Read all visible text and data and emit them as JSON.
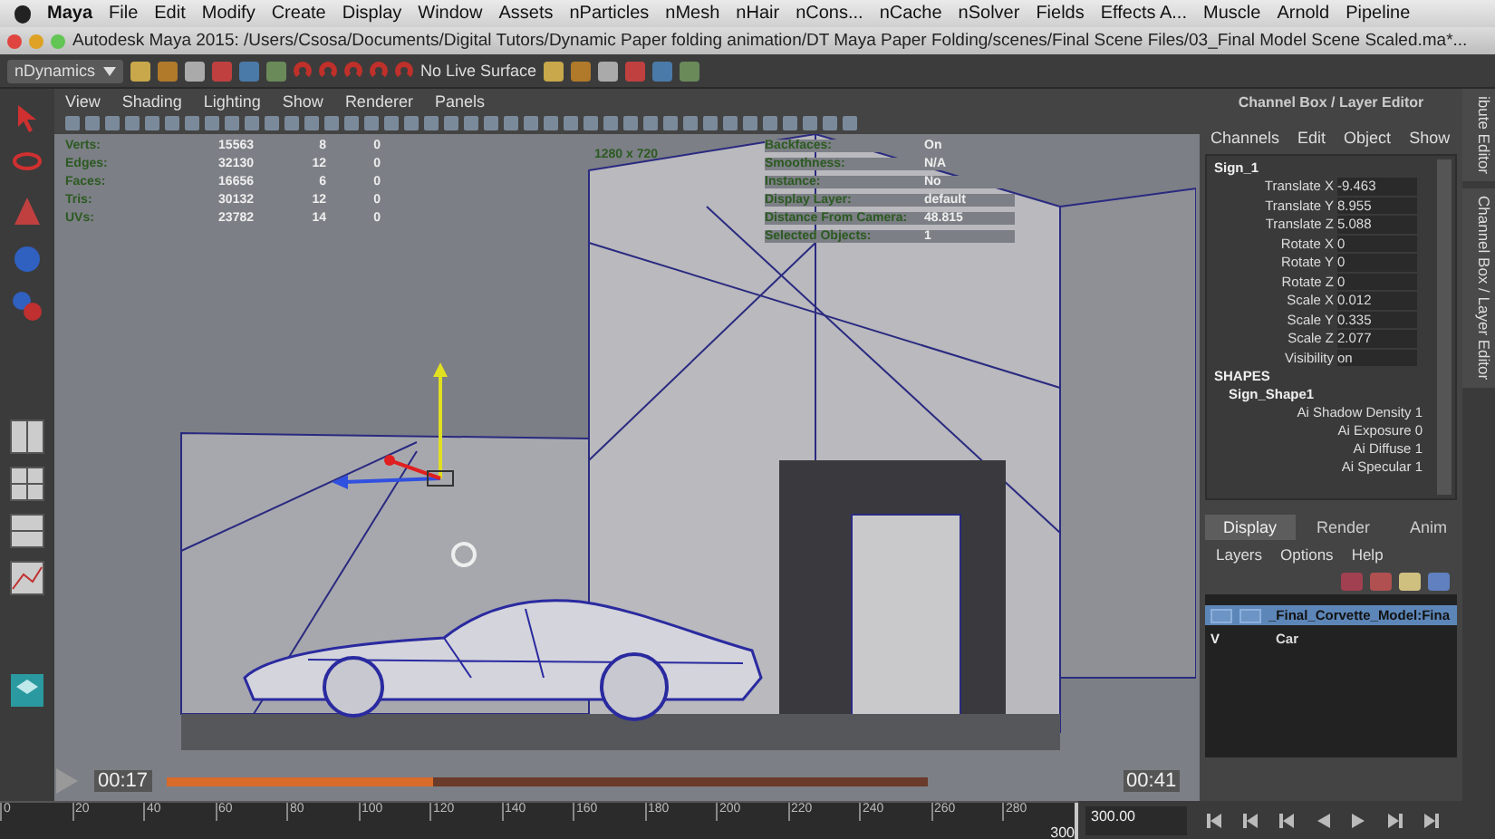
{
  "menu_bar": {
    "app": "Maya",
    "items": [
      "File",
      "Edit",
      "Modify",
      "Create",
      "Display",
      "Window",
      "Assets",
      "nParticles",
      "nMesh",
      "nHair",
      "nCons...",
      "nCache",
      "nSolver",
      "Fields",
      "Effects A...",
      "Muscle",
      "Arnold",
      "Pipeline"
    ]
  },
  "title_bar": {
    "title": "Autodesk Maya 2015: /Users/Csosa/Documents/Digital Tutors/Dynamic Paper folding animation/DT Maya Paper Folding/scenes/Final Scene Files/03_Final Model Scene Scaled.ma*..."
  },
  "toolbar": {
    "menu_set": "nDynamics",
    "live_surface": "No Live Surface"
  },
  "viewport": {
    "menus": [
      "View",
      "Shading",
      "Lighting",
      "Show",
      "Renderer",
      "Panels"
    ],
    "resolution": "1280 x 720",
    "hud_stats": [
      {
        "label": "Verts:",
        "values": [
          "15563",
          "8",
          "0"
        ]
      },
      {
        "label": "Edges:",
        "values": [
          "32130",
          "12",
          "0"
        ]
      },
      {
        "label": "Faces:",
        "values": [
          "16656",
          "6",
          "0"
        ]
      },
      {
        "label": "Tris:",
        "values": [
          "30132",
          "12",
          "0"
        ]
      },
      {
        "label": "UVs:",
        "values": [
          "23782",
          "14",
          "0"
        ]
      }
    ],
    "hud_info": [
      {
        "label": "Backfaces:",
        "value": "On"
      },
      {
        "label": "Smoothness:",
        "value": "N/A"
      },
      {
        "label": "Instance:",
        "value": "No"
      },
      {
        "label": "Display Layer:",
        "value": "default"
      },
      {
        "label": "Distance From Camera:",
        "value": "48.815"
      },
      {
        "label": "Selected Objects:",
        "value": "1"
      }
    ]
  },
  "video_player": {
    "elapsed": "00:17",
    "remaining": "00:41",
    "level": 0.35
  },
  "channel_box": {
    "title": "Channel Box / Layer Editor",
    "menus": [
      "Channels",
      "Edit",
      "Object",
      "Show"
    ],
    "object": "Sign_1",
    "channels": [
      {
        "name": "Translate X",
        "value": "-9.463"
      },
      {
        "name": "Translate Y",
        "value": "8.955"
      },
      {
        "name": "Translate Z",
        "value": "5.088"
      },
      {
        "name": "Rotate X",
        "value": "0"
      },
      {
        "name": "Rotate Y",
        "value": "0"
      },
      {
        "name": "Rotate Z",
        "value": "0"
      },
      {
        "name": "Scale X",
        "value": "0.012"
      },
      {
        "name": "Scale Y",
        "value": "0.335"
      },
      {
        "name": "Scale Z",
        "value": "2.077"
      },
      {
        "name": "Visibility",
        "value": "on"
      }
    ],
    "shapes_header": "SHAPES",
    "shape": "Sign_Shape1",
    "shape_channels": [
      {
        "name": "Ai Shadow Density",
        "value": "1"
      },
      {
        "name": "Ai Exposure",
        "value": "0"
      },
      {
        "name": "Ai Diffuse",
        "value": "1"
      },
      {
        "name": "Ai Specular",
        "value": "1"
      }
    ]
  },
  "layer_editor": {
    "tabs": [
      {
        "label": "Display",
        "selected": true
      },
      {
        "label": "Render",
        "selected": false
      },
      {
        "label": "Anim",
        "selected": false
      }
    ],
    "menus": [
      "Layers",
      "Options",
      "Help"
    ],
    "layers": [
      {
        "name": "_Final_Corvette_Model:Fina",
        "selected": true
      },
      {
        "flag": "V",
        "name": "Car",
        "selected": false
      }
    ]
  },
  "side_tabs": [
    "ibute Editor",
    "Channel Box / Layer Editor"
  ],
  "timeline": {
    "ticks": [
      "0",
      "20",
      "40",
      "60",
      "80",
      "100",
      "120",
      "140",
      "160",
      "180",
      "200",
      "220",
      "240",
      "260",
      "280"
    ],
    "current": "300",
    "level": 1,
    "range_end": "300.00"
  }
}
